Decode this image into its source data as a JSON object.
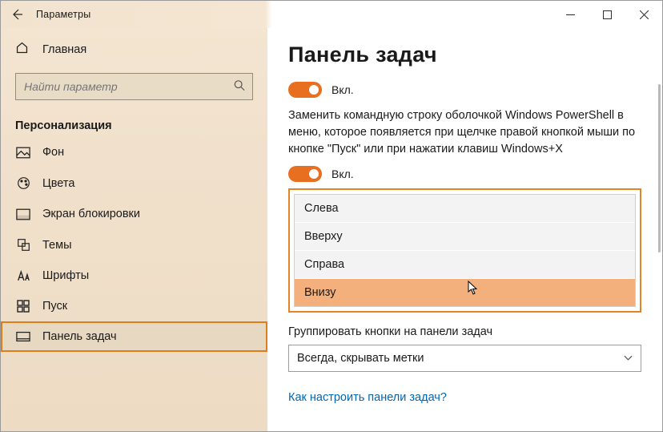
{
  "window_title": "Параметры",
  "home_label": "Главная",
  "search_placeholder": "Найти параметр",
  "section_title": "Персонализация",
  "nav": {
    "items": [
      {
        "label": "Фон"
      },
      {
        "label": "Цвета"
      },
      {
        "label": "Экран блокировки"
      },
      {
        "label": "Темы"
      },
      {
        "label": "Шрифты"
      },
      {
        "label": "Пуск"
      },
      {
        "label": "Панель задач"
      }
    ]
  },
  "page_title": "Панель задач",
  "toggle1_label": "Вкл.",
  "description": "Заменить командную строку оболочкой Windows PowerShell в меню, которое появляется при щелчке правой кнопкой мыши по кнопке \"Пуск\" или при нажатии клавиш Windows+X",
  "toggle2_label": "Вкл.",
  "dropdown": {
    "options": [
      "Слева",
      "Вверху",
      "Справа",
      "Внизу"
    ],
    "selected_index": 3
  },
  "group_label": "Группировать кнопки на панели задач",
  "combo_value": "Всегда, скрывать метки",
  "help_link": "Как настроить панели задач?"
}
